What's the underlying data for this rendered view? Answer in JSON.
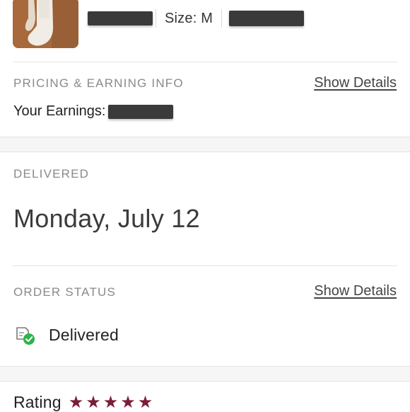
{
  "product": {
    "thumbnail_icon": "sock-photo",
    "size_label": "Size: M"
  },
  "pricing": {
    "heading": "PRICING & EARNING INFO",
    "show_details": "Show Details",
    "earnings_label": "Your Earnings:"
  },
  "delivered": {
    "heading": "DELIVERED",
    "date": "Monday, July 12"
  },
  "order_status": {
    "heading": "ORDER STATUS",
    "show_details": "Show Details",
    "status": "Delivered",
    "status_icon": "package-check-icon"
  },
  "rating": {
    "label": "Rating",
    "stars": 5,
    "max_stars": 5,
    "star_color": "#7a1e3a"
  },
  "colors": {
    "accent": "#7a1e3a",
    "success": "#2db34a",
    "muted_text": "#8a8a8a"
  }
}
